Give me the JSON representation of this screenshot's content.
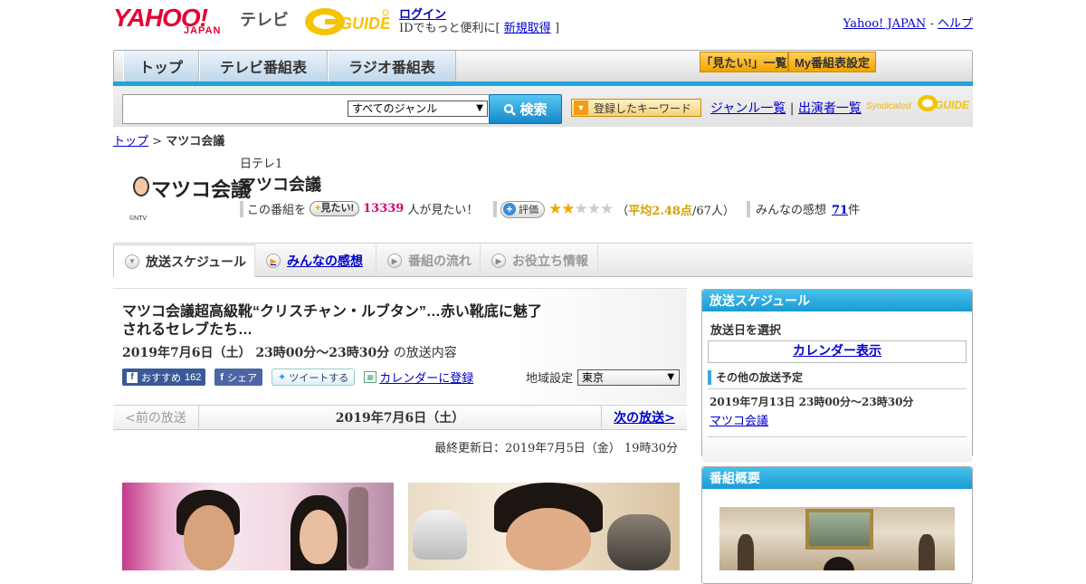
{
  "header": {
    "logo_yahoo": "YAHOO!",
    "logo_japan": "JAPAN",
    "logo_tv": "テレビ",
    "gguide_alt": "G-GUIDE",
    "login_link": "ログイン",
    "login_sub_prefix": "IDでもっと便利に[",
    "signup_link": "新規取得",
    "login_sub_suffix": "]",
    "yahoo_japan_link": "Yahoo! JAPAN",
    "separator": "-",
    "help_link": "ヘルプ"
  },
  "nav": {
    "tabs": [
      "トップ",
      "テレビ番組表",
      "ラジオ番組表"
    ],
    "mitai_list": "「見たい!」一覧",
    "my_bangumi": "My番組表設定"
  },
  "search": {
    "genre_selected": "すべてのジャンル",
    "search_button": "検索",
    "keyword_button": "登録したキーワード",
    "genre_list_link": "ジャンル一覧",
    "divider": "|",
    "performer_list_link": "出演者一覧",
    "syndicated": "Syndicated"
  },
  "breadcrumb": {
    "top": "トップ",
    "sep": ">",
    "current": "マツコ会議"
  },
  "program": {
    "logo_text": "マツコ会議",
    "logo_copyright": "©NTV",
    "channel": "日テレ1",
    "title": "マツコ会議",
    "want_prefix": "この番組を",
    "want_button": "見たい!",
    "want_count": "13339",
    "want_suffix": "人が見たい！",
    "rate_button": "評価",
    "stars_on": 2,
    "stars_total": 5,
    "avg_open": "（",
    "avg_label": "平均2.48点",
    "avg_votes": "/67人）",
    "impressions_label": "みんなの感想",
    "impressions_count": "71",
    "impressions_unit": "件"
  },
  "tabs": [
    {
      "label": "放送スケジュール",
      "state": "active"
    },
    {
      "label": "みんなの感想",
      "state": "link"
    },
    {
      "label": "番組の流れ",
      "state": "disabled"
    },
    {
      "label": "お役立ち情報",
      "state": "disabled"
    }
  ],
  "episode": {
    "headline": "マツコ会議超高級靴“クリスチャン・ルブタン”…赤い靴底に魅了されるセレブたち…",
    "airdate": "2019年7月6日（土）  23時00分～23時30分",
    "airdate_suffix": "の放送内容",
    "fb_recommend": "おすすめ",
    "fb_count": "162",
    "fb_share": "シェア",
    "tweet": "ツイートする",
    "calendar": "カレンダーに登録",
    "region_label": "地域設定",
    "region_value": "東京"
  },
  "pager": {
    "prev": "<前の放送",
    "date": "2019年7月6日（土）",
    "next": "次の放送>"
  },
  "updated": "最終更新日：2019年7月5日（金）  19時30分",
  "sidebar": {
    "schedule_title": "放送スケジュール",
    "select_date": "放送日を選択",
    "calendar_display": "カレンダー表示",
    "other_title": "その他の放送予定",
    "other_date": "2019年7月13日  23時00分～23時30分",
    "other_link": "マツコ会議",
    "overview_title": "番組概要"
  },
  "colors": {
    "accent_blue": "#1fa4db",
    "orange": "#f39c12",
    "pink_count": "#d6006f",
    "yahoo_red": "#e60033"
  }
}
